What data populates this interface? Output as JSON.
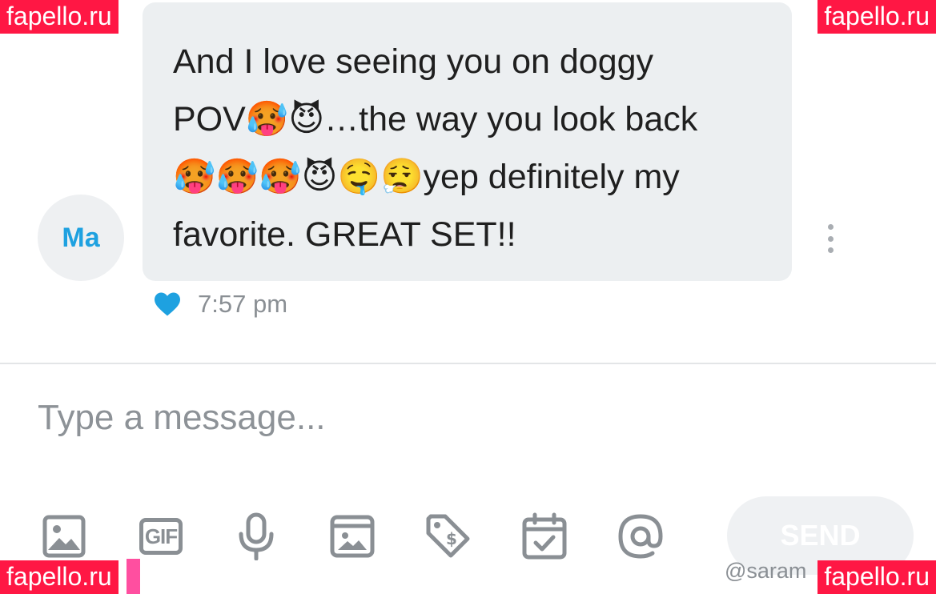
{
  "watermarks": {
    "top_left": "fapello.ru",
    "top_right": "fapello.ru",
    "bottom_left": "fapello.ru",
    "bottom_right": "fapello.ru"
  },
  "message": {
    "sender_initials": "Ma",
    "lines": [
      "And I love seeing you on doggy",
      "POV🥵😈…the way you look back",
      "🥵🥵🥵😈🤤😮‍💨yep definitely my",
      "favorite. GREAT SET!!"
    ],
    "time": "7:57 pm",
    "liked": true
  },
  "composer": {
    "placeholder": "Type a message...",
    "send_label": "SEND"
  },
  "toolbar": {
    "gif_label": "GIF",
    "icons": [
      "image-icon",
      "gif-icon",
      "microphone-icon",
      "vault-media-icon",
      "price-tag-icon",
      "schedule-calendar-icon",
      "mention-at-icon"
    ]
  },
  "footer": {
    "handle": "@saram"
  },
  "colors": {
    "accent": "#1ea1e0",
    "watermark": "#ff1744",
    "bubble": "#eceff1",
    "icon_gray": "#8a8f94"
  }
}
